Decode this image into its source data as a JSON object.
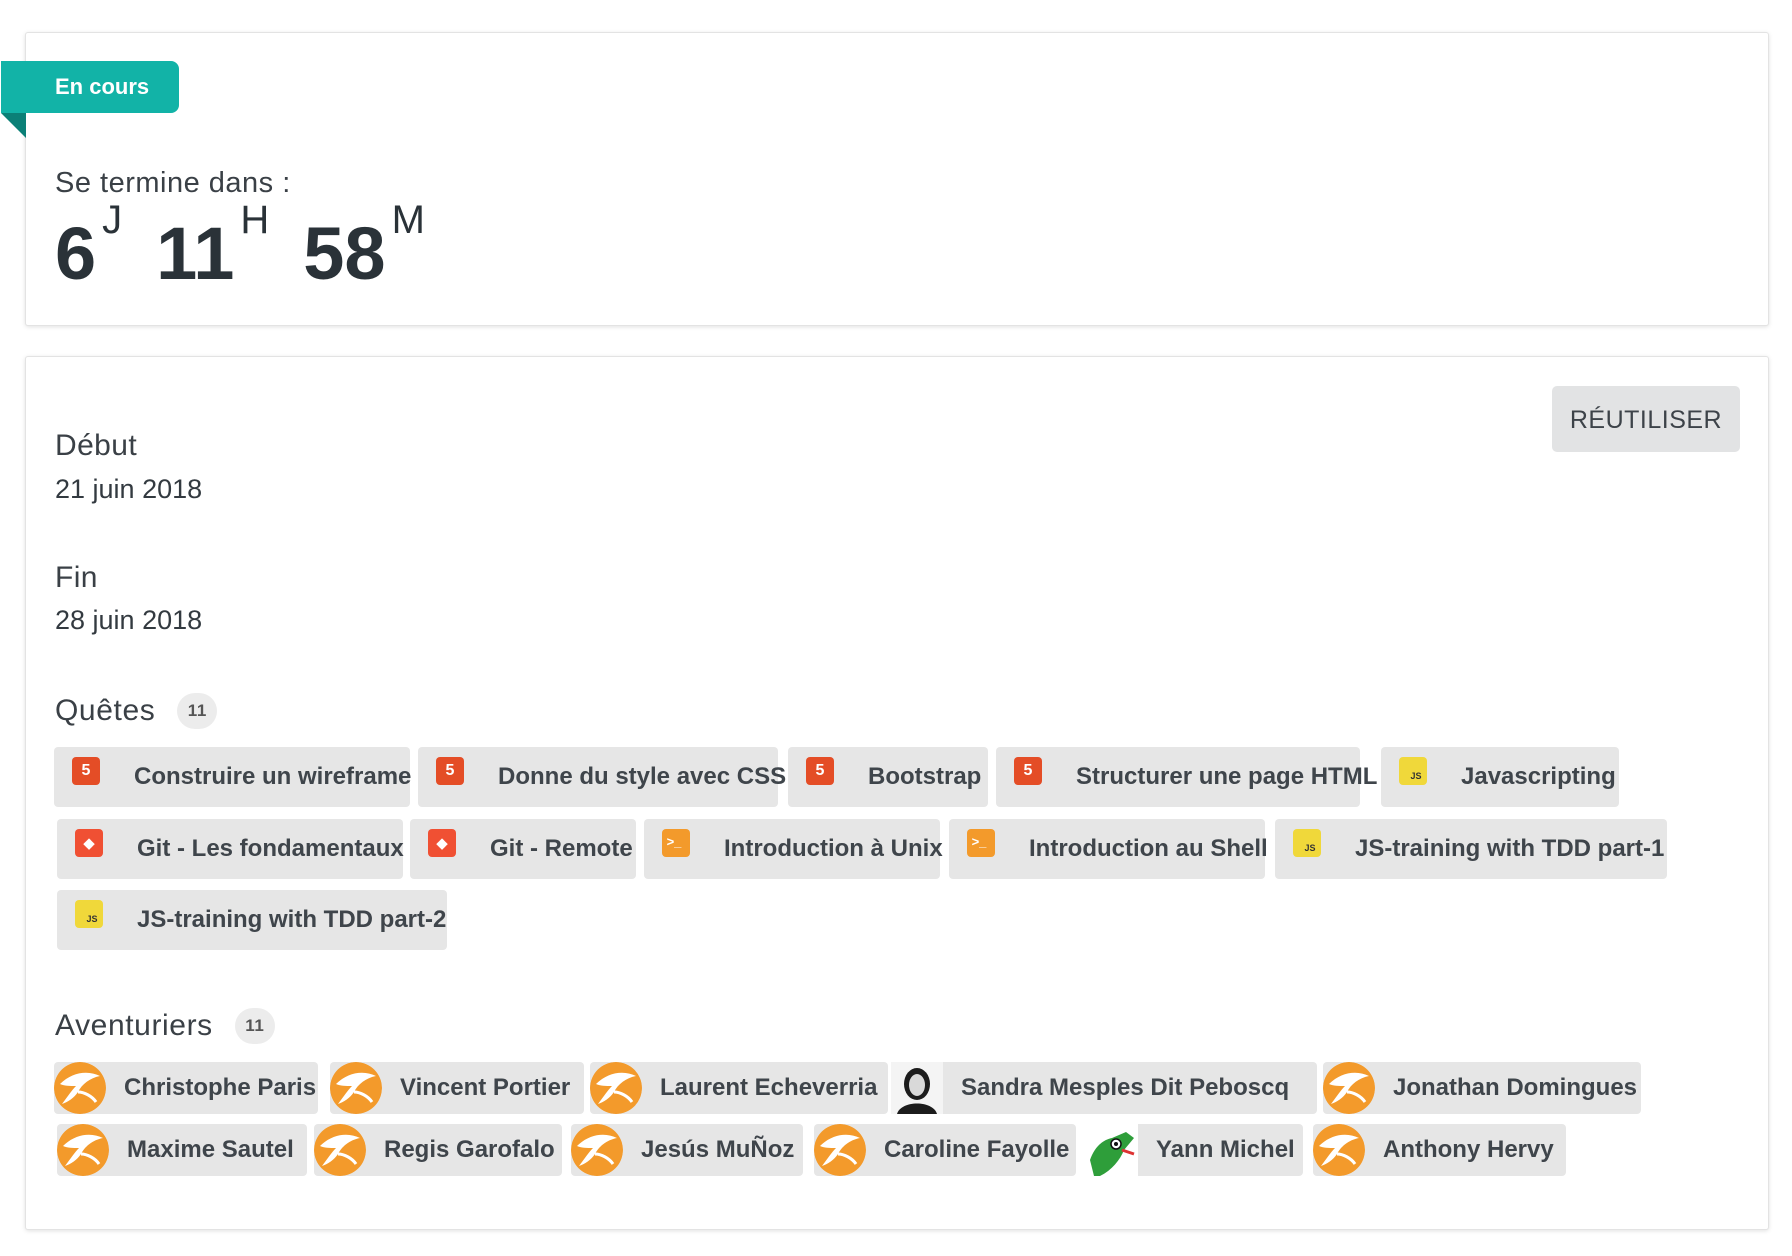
{
  "status": {
    "badge": "En cours",
    "ends_label": "Se termine dans :",
    "countdown": {
      "days": "6",
      "days_unit": "J",
      "hours": "11",
      "hours_unit": "H",
      "minutes": "58",
      "minutes_unit": "M"
    }
  },
  "session": {
    "reuse_label": "RÉUTILISER",
    "start_label": "Début",
    "start_value": "21 juin 2018",
    "end_label": "Fin",
    "end_value": "28 juin 2018",
    "quests_title": "Quêtes",
    "quests_count": "11",
    "quests": [
      {
        "label": "Construire un wireframe",
        "icon": "html5-icon"
      },
      {
        "label": "Donne du style avec CSS",
        "icon": "html5-icon"
      },
      {
        "label": "Bootstrap",
        "icon": "html5-icon"
      },
      {
        "label": "Structurer une page HTML",
        "icon": "html5-icon"
      },
      {
        "label": "Javascripting",
        "icon": "js-icon"
      },
      {
        "label": "Git - Les fondamentaux",
        "icon": "git-icon"
      },
      {
        "label": "Git - Remote",
        "icon": "git-icon"
      },
      {
        "label": "Introduction à Unix",
        "icon": "terminal-icon"
      },
      {
        "label": "Introduction au Shell",
        "icon": "terminal-icon"
      },
      {
        "label": "JS-training with TDD part-1",
        "icon": "js-icon"
      },
      {
        "label": "JS-training with TDD part-2",
        "icon": "js-icon"
      }
    ],
    "adventurers_title": "Aventuriers",
    "adventurers_count": "11",
    "adventurers": [
      {
        "name": "Christophe Paris",
        "avatar": "default-avatar-icon"
      },
      {
        "name": "Vincent Portier",
        "avatar": "default-avatar-icon"
      },
      {
        "name": "Laurent Echeverria",
        "avatar": "default-avatar-icon"
      },
      {
        "name": "Sandra Mesples Dit Peboscq",
        "avatar": "photo-avatar"
      },
      {
        "name": "Jonathan Domingues",
        "avatar": "default-avatar-icon"
      },
      {
        "name": "Maxime Sautel",
        "avatar": "default-avatar-icon"
      },
      {
        "name": "Regis Garofalo",
        "avatar": "default-avatar-icon"
      },
      {
        "name": "Jesús MuÑoz",
        "avatar": "default-avatar-icon"
      },
      {
        "name": "Caroline Fayolle",
        "avatar": "default-avatar-icon"
      },
      {
        "name": "Yann Michel",
        "avatar": "cartoon-avatar"
      },
      {
        "name": "Anthony Hervy",
        "avatar": "default-avatar-icon"
      }
    ]
  },
  "colors": {
    "badge": "#12b3a7",
    "html5": "#e44d26",
    "git": "#f05033",
    "terminal": "#f39a2b",
    "js": "#f0d83a",
    "avatar": "#f39a2b"
  }
}
